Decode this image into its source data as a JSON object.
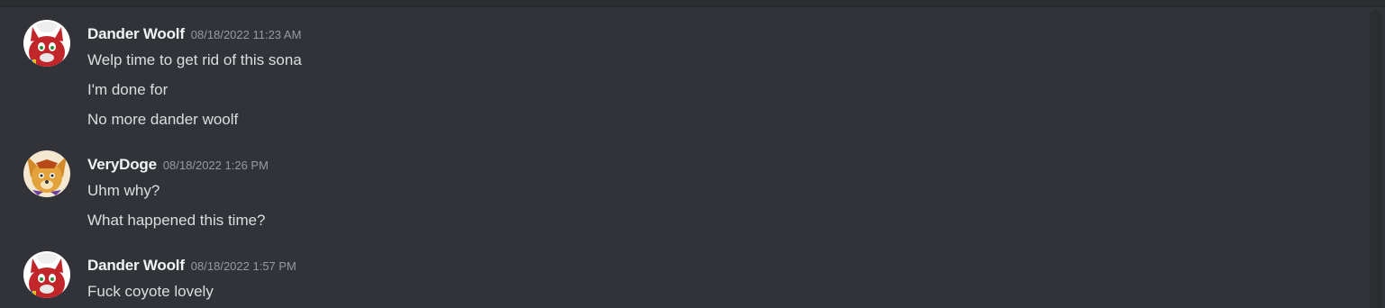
{
  "messages": [
    {
      "author": "Dander Woolf",
      "timestamp": "08/18/2022 11:23 AM",
      "avatar_icon": "red-wolf-avatar-icon",
      "lines": [
        "Welp time to get rid of this sona",
        "I'm done for",
        "No more dander woolf"
      ]
    },
    {
      "author": "VeryDoge",
      "timestamp": "08/18/2022 1:26 PM",
      "avatar_icon": "orange-dog-avatar-icon",
      "lines": [
        "Uhm why?",
        "What happened this time?"
      ]
    },
    {
      "author": "Dander Woolf",
      "timestamp": "08/18/2022 1:57 PM",
      "avatar_icon": "red-wolf-avatar-icon",
      "lines": [
        "Fuck coyote lovely"
      ]
    }
  ],
  "colors": {
    "background": "#313338",
    "username": "#f2f3f5",
    "timestamp": "#949ba4",
    "message_text": "#dbdee1"
  }
}
